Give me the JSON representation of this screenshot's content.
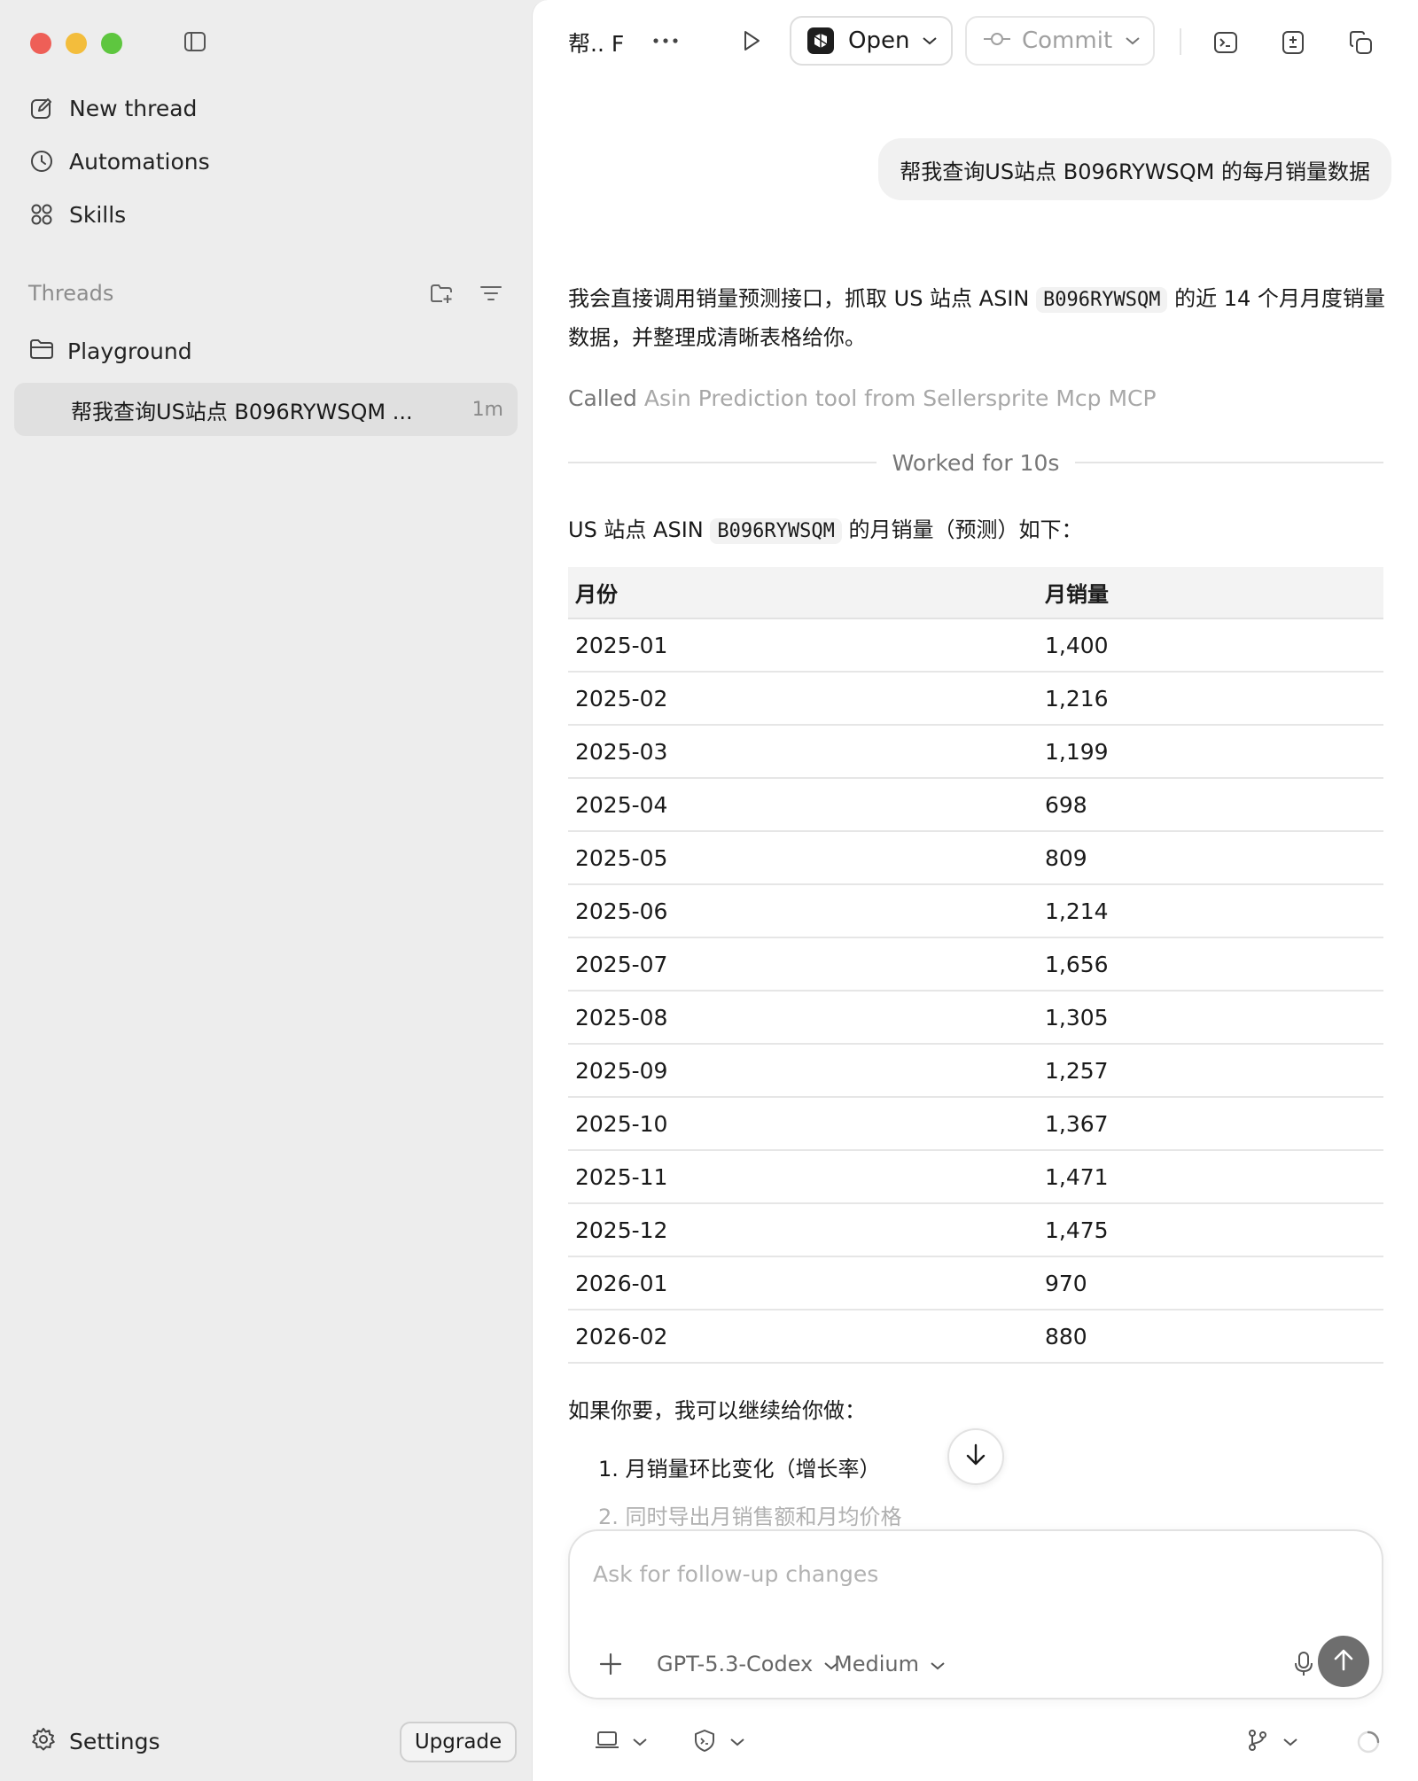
{
  "sidebar": {
    "nav": [
      {
        "label": "New thread",
        "icon": "edit-icon"
      },
      {
        "label": "Automations",
        "icon": "clock-icon"
      },
      {
        "label": "Skills",
        "icon": "grid-icon"
      }
    ],
    "threads_label": "Threads",
    "project": {
      "label": "Playground",
      "icon": "folder-icon"
    },
    "active_thread": {
      "title": "帮我查询US站点 B096RYWSQM ...",
      "age": "1m"
    },
    "settings_label": "Settings",
    "upgrade_label": "Upgrade"
  },
  "topbar": {
    "title": "帮.. F",
    "open_label": "Open",
    "commit_label": "Commit"
  },
  "chat": {
    "user_message": "帮我查询US站点 B096RYWSQM 的每月销量数据",
    "intro_before": "我会直接调用销量预测接口，抓取 US 站点 ASIN ",
    "asin": "B096RYWSQM",
    "intro_after": " 的近 14 个月月度销量数据，并整理成清晰表格给你。",
    "called_verb": "Called",
    "called_tool": "Asin Prediction tool from Sellersprite Mcp MCP",
    "worked_label": "Worked for 10s",
    "table_intro_before": "US 站点 ASIN ",
    "table_intro_after": " 的月销量（预测）如下：",
    "table": {
      "headers": [
        "月份",
        "月销量"
      ],
      "rows": [
        [
          "2025-01",
          "1,400"
        ],
        [
          "2025-02",
          "1,216"
        ],
        [
          "2025-03",
          "1,199"
        ],
        [
          "2025-04",
          "698"
        ],
        [
          "2025-05",
          "809"
        ],
        [
          "2025-06",
          "1,214"
        ],
        [
          "2025-07",
          "1,656"
        ],
        [
          "2025-08",
          "1,305"
        ],
        [
          "2025-09",
          "1,257"
        ],
        [
          "2025-10",
          "1,367"
        ],
        [
          "2025-11",
          "1,471"
        ],
        [
          "2025-12",
          "1,475"
        ],
        [
          "2026-01",
          "970"
        ],
        [
          "2026-02",
          "880"
        ]
      ]
    },
    "followup_intro": "如果你要，我可以继续给你做：",
    "followups": [
      "1. 月销量环比变化（增长率）",
      "2. 同时导出月销售额和月均价格"
    ]
  },
  "composer": {
    "placeholder": "Ask for follow-up changes",
    "model": "GPT-5.3-Codex",
    "effort": "Medium"
  },
  "colors": {
    "sidebar_bg": "#ededed",
    "main_bg": "#ffffff",
    "send_button": "#6e6e6e",
    "traffic_red": "#ee5f57",
    "traffic_yellow": "#f3bd3c",
    "traffic_green": "#5ec63f"
  }
}
